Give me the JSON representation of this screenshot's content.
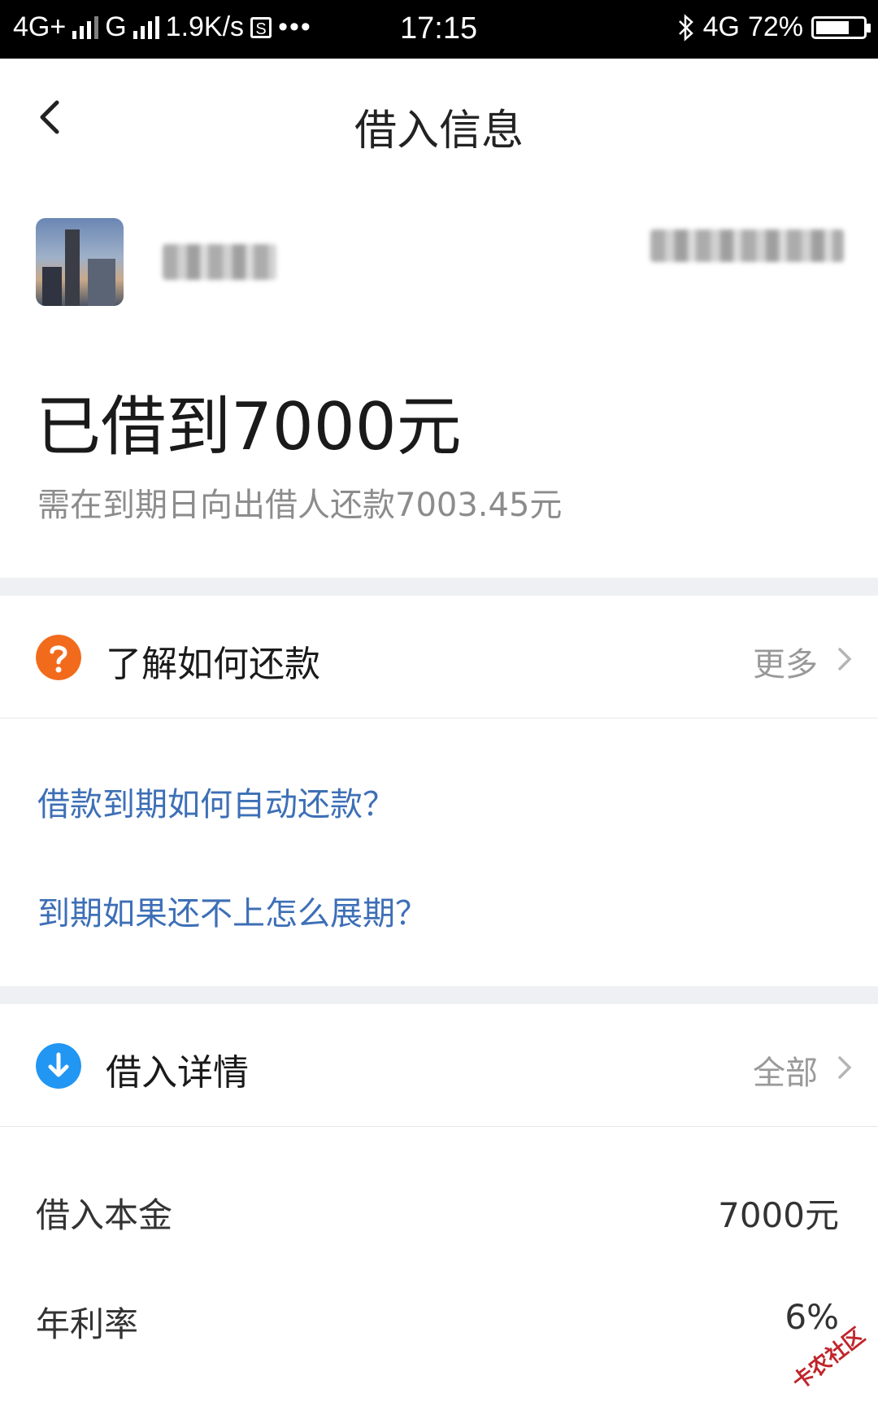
{
  "status_bar": {
    "network1": "4G+",
    "network2": "G",
    "speed": "1.9K/s",
    "time": "17:15",
    "network3": "4G",
    "battery_pct": "72%",
    "battery_level": 0.72
  },
  "nav": {
    "title": "借入信息"
  },
  "loan": {
    "headline": "已借到7000元",
    "subtitle": "需在到期日向出借人还款7003.45元"
  },
  "repay_section": {
    "title": "了解如何还款",
    "more_label": "更多",
    "links": [
      "借款到期如何自动还款？",
      "到期如果还不上怎么展期？"
    ]
  },
  "detail_section": {
    "title": "借入详情",
    "all_label": "全部",
    "rows": [
      {
        "label": "借入本金",
        "value": "7000元"
      },
      {
        "label": "年利率",
        "value": "6%"
      }
    ]
  },
  "watermark": "卡农社区",
  "colors": {
    "accent_link": "#3d6fb6",
    "help_icon": "#f26b1d",
    "download_icon": "#2196f3",
    "separator": "#eef0f4"
  },
  "icons": {
    "back": "chevron-left-icon",
    "help": "question-icon",
    "detail": "arrow-down-icon",
    "more": "chevron-right-icon"
  }
}
